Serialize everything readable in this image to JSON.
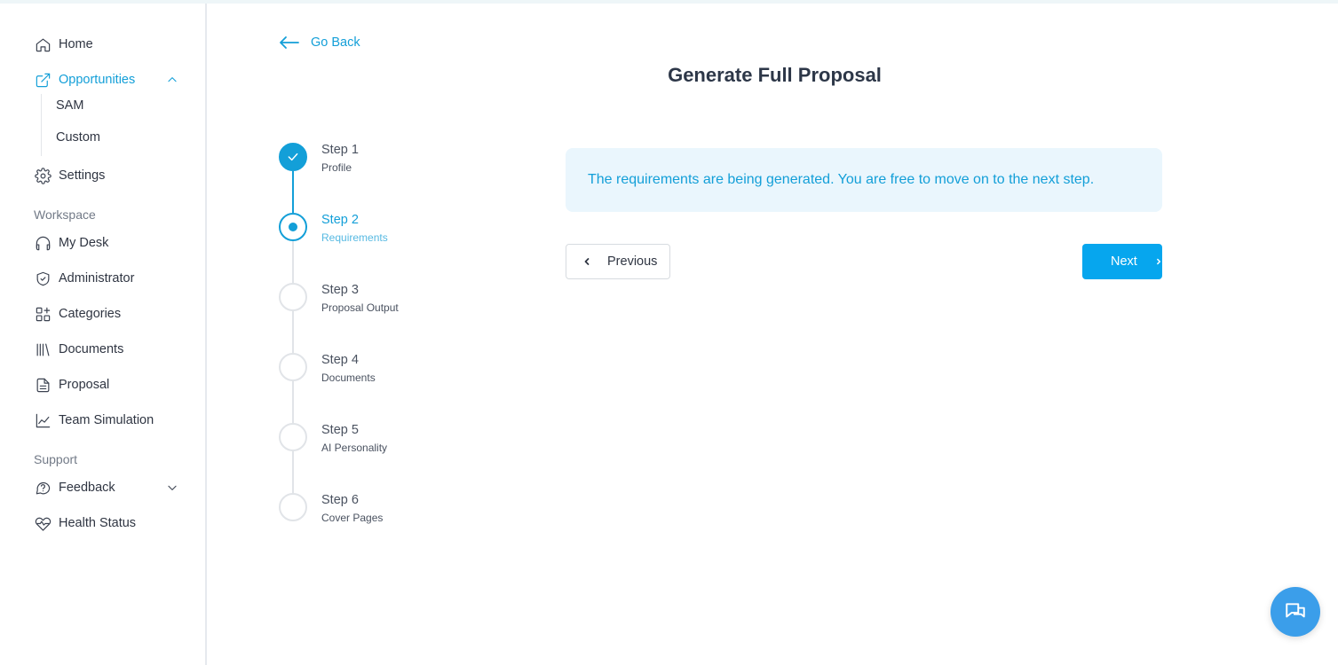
{
  "sidebar": {
    "home": "Home",
    "opportunities": "Opportunities",
    "opportunities_sub": [
      "SAM",
      "Custom"
    ],
    "settings": "Settings",
    "workspace_label": "Workspace",
    "workspace_items": [
      "My Desk",
      "Administrator",
      "Categories",
      "Documents",
      "Proposal",
      "Team Simulation"
    ],
    "support_label": "Support",
    "feedback": "Feedback",
    "health_status": "Health Status"
  },
  "header": {
    "go_back": "Go Back",
    "title": "Generate Full Proposal"
  },
  "steps": [
    {
      "title": "Step 1",
      "subtitle": "Profile",
      "status": "done"
    },
    {
      "title": "Step 2",
      "subtitle": "Requirements",
      "status": "current"
    },
    {
      "title": "Step 3",
      "subtitle": "Proposal Output",
      "status": "pending"
    },
    {
      "title": "Step 4",
      "subtitle": "Documents",
      "status": "pending"
    },
    {
      "title": "Step 5",
      "subtitle": "AI Personality",
      "status": "pending"
    },
    {
      "title": "Step 6",
      "subtitle": "Cover Pages",
      "status": "pending"
    }
  ],
  "notice": "The requirements are being generated. You are free to move on to the next step.",
  "buttons": {
    "previous": "Previous",
    "next": "Next"
  },
  "colors": {
    "accent": "#139fd8",
    "next_button": "#06a6ee",
    "notice_bg": "#eaf6fd",
    "chat_button": "#3b9eea"
  }
}
